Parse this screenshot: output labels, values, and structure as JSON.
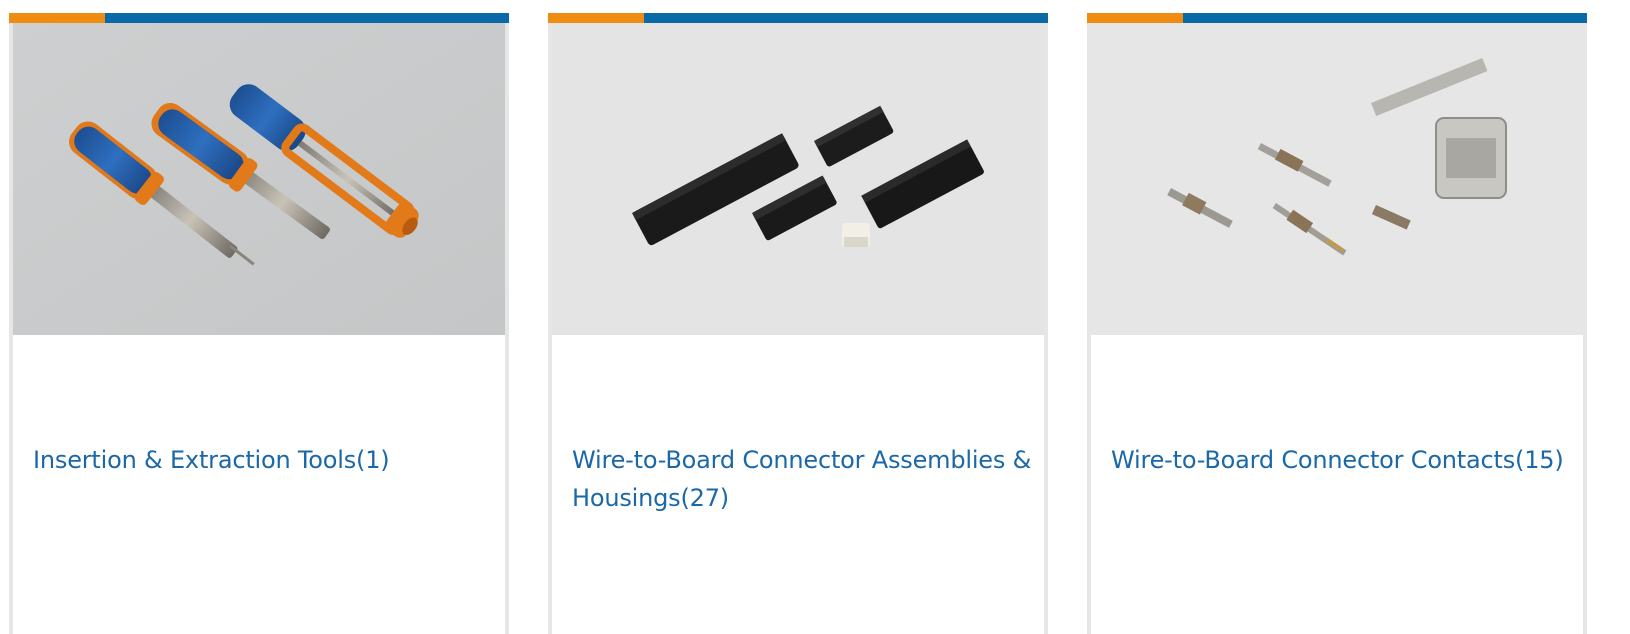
{
  "theme": {
    "accent_orange": "#f08c12",
    "accent_blue": "#0a6aa8",
    "link_color": "#1b68a8",
    "card_border": "#e6e6e6"
  },
  "categories": [
    {
      "label": "Insertion & Extraction Tools(1)",
      "image_icon": "extraction-tools-photo"
    },
    {
      "label": "Wire-to-Board Connector Assemblies & Housings(27)",
      "image_icon": "connector-housings-photo"
    },
    {
      "label": "Wire-to-Board Connector Contacts(15)",
      "image_icon": "connector-contacts-photo"
    }
  ]
}
